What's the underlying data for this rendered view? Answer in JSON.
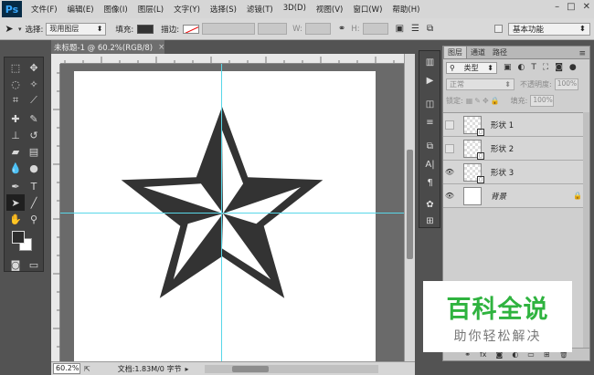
{
  "app": {
    "logo": "Ps"
  },
  "menu": [
    "文件(F)",
    "编辑(E)",
    "图像(I)",
    "图层(L)",
    "文字(Y)",
    "选择(S)",
    "滤镜(T)",
    "3D(D)",
    "视图(V)",
    "窗口(W)",
    "帮助(H)"
  ],
  "window_controls": {
    "minimize": "–",
    "restore": "□",
    "close": "✕"
  },
  "options": {
    "select_label": "选择:",
    "select_value": "现用图层",
    "fill_label": "填充:",
    "stroke_label": "描边:",
    "w_label": "W:",
    "h_label": "H:",
    "workspace": "基本功能",
    "fill_color": "#333333"
  },
  "document": {
    "tab_title": "未标题-1 @ 60.2%(RGB/8)",
    "tab_close": "×",
    "star_color": "#333333"
  },
  "status": {
    "zoom": "60.2%",
    "doc_info": "文档:1.83M/0 字节"
  },
  "layers_panel": {
    "tabs": [
      "图层",
      "通道",
      "路径"
    ],
    "kind_filter": "类型",
    "blend_mode": "正常",
    "opacity_label": "不透明度:",
    "opacity_value": "100%",
    "lock_label": "锁定:",
    "fill_label": "填充:",
    "fill_value": "100%",
    "layers": [
      {
        "name": "形状 1",
        "visible": false
      },
      {
        "name": "形状 2",
        "visible": false
      },
      {
        "name": "形状 3",
        "visible": true
      },
      {
        "name": "背景",
        "visible": true,
        "locked": true
      }
    ]
  },
  "watermark": {
    "title": "百科全说",
    "subtitle": "助你轻松解决"
  }
}
